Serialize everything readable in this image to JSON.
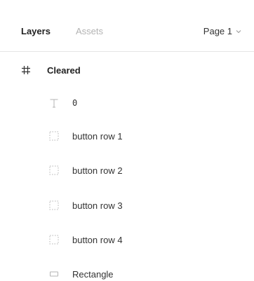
{
  "header": {
    "tabs": [
      {
        "label": "Layers"
      },
      {
        "label": "Assets"
      }
    ],
    "page": "Page 1"
  },
  "layers": {
    "frame": {
      "name": "Cleared",
      "icon": "frame-hash-icon"
    },
    "children": [
      {
        "name": "0",
        "icon": "text-icon"
      },
      {
        "name": "button row 1",
        "icon": "group-dotted-icon"
      },
      {
        "name": "button row 2",
        "icon": "group-dotted-icon"
      },
      {
        "name": "button row 3",
        "icon": "group-dotted-icon"
      },
      {
        "name": "button row 4",
        "icon": "group-dotted-icon"
      },
      {
        "name": "Rectangle",
        "icon": "rectangle-icon"
      }
    ]
  },
  "colors": {
    "text_primary": "#222222",
    "text_muted": "#b3b3b3",
    "icon": "#b3b3b3",
    "divider": "#e5e5e5"
  }
}
